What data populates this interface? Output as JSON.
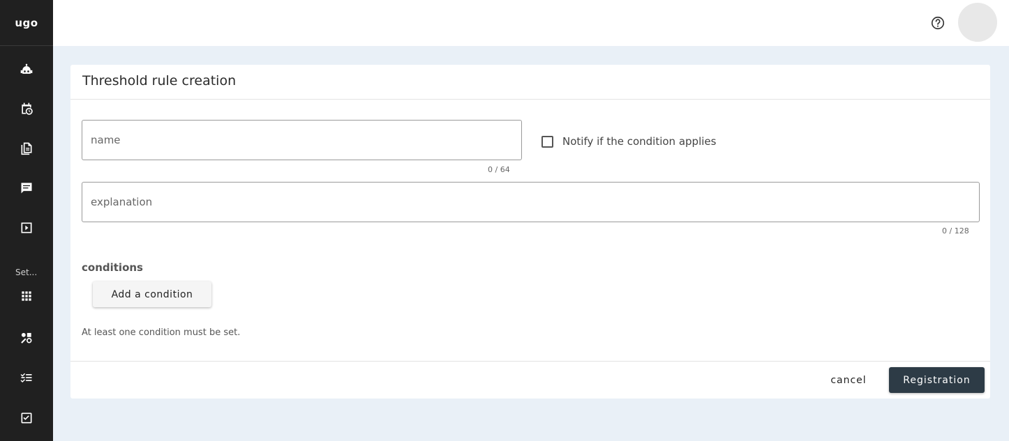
{
  "app": {
    "logo_text": "ugo"
  },
  "sidebar": {
    "section_label": "Set...",
    "icons": [
      "robot-icon",
      "calendar-clock-icon",
      "documents-icon",
      "chat-icon",
      "play-box-icon",
      "grid-icon",
      "shapes-icon",
      "checklist-icon",
      "checkbox-icon"
    ]
  },
  "header": {
    "help_icon": "help-circle-icon"
  },
  "form": {
    "title": "Threshold rule creation",
    "name_placeholder": "name",
    "name_counter": "0 / 64",
    "notify_label": "Notify if the condition applies",
    "explanation_placeholder": "explanation",
    "explanation_counter": "0 / 128",
    "conditions_label": "conditions",
    "add_condition_label": "Add a condition",
    "hint": "At least one condition must be set.",
    "cancel_label": "cancel",
    "register_label": "Registration"
  },
  "colors": {
    "sidebar_bg": "#202020",
    "page_bg": "#e9f0f7",
    "primary_button": "#2d3b46"
  }
}
